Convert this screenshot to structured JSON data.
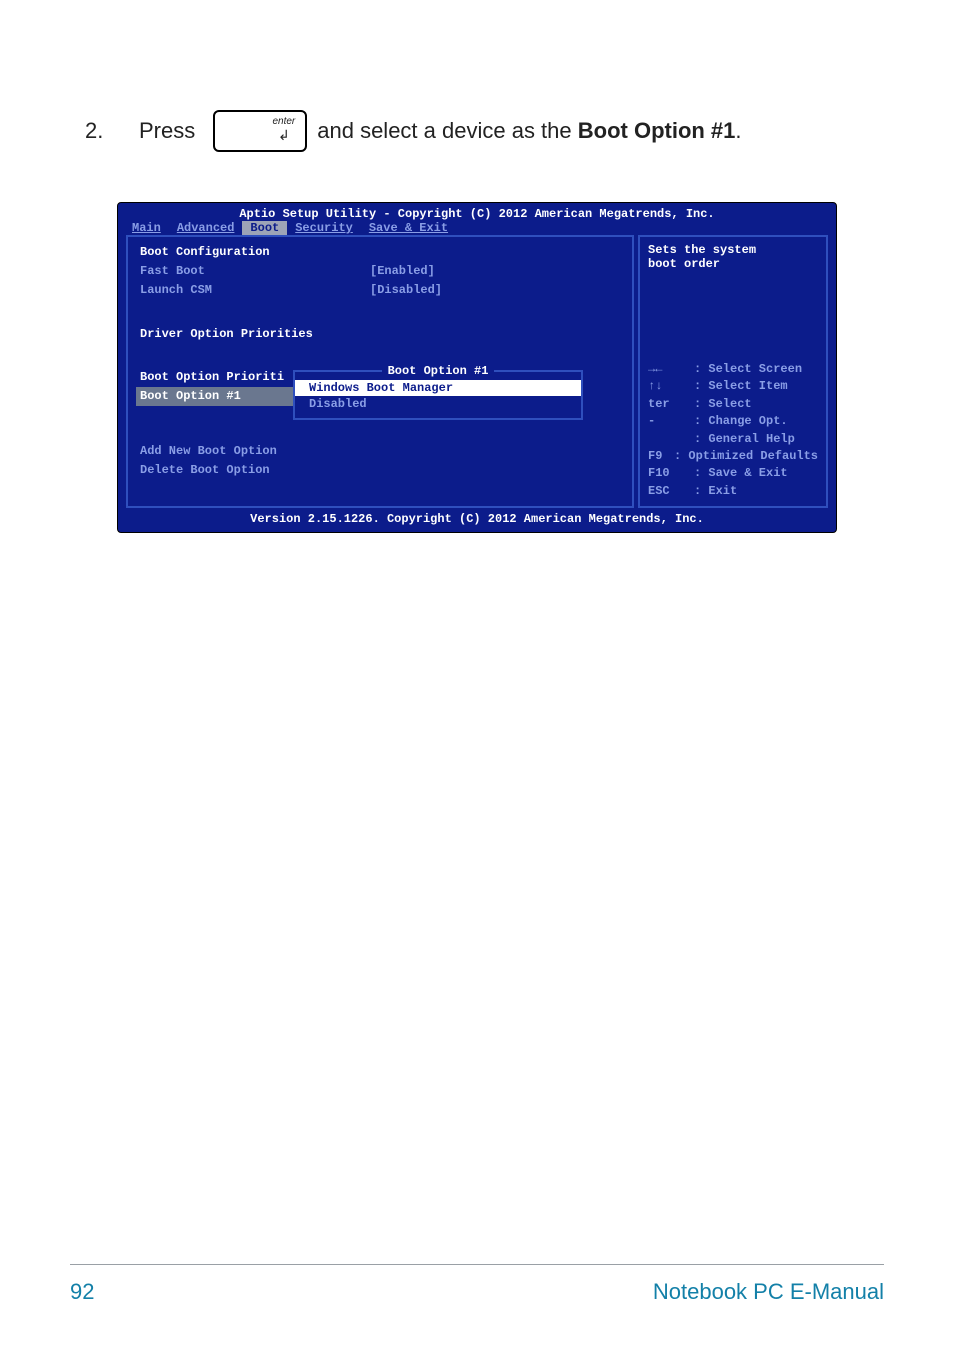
{
  "step": {
    "number": "2.",
    "press_label": "Press",
    "key_label": "enter",
    "tail_before": " and select a device as the ",
    "tail_bold": "Boot Option #1",
    "tail_after": "."
  },
  "bios": {
    "header": "Aptio Setup Utility - Copyright (C) 2012 American Megatrends, Inc.",
    "tabs": {
      "main": "Main",
      "advanced": "Advanced",
      "boot": "Boot",
      "security": "Security",
      "save_exit": "Save & Exit"
    },
    "left": {
      "boot_config": "Boot Configuration",
      "fast_boot_label": "Fast Boot",
      "fast_boot_value": "[Enabled]",
      "launch_csm_label": "Launch CSM",
      "launch_csm_value": "[Disabled]",
      "driver_priorities": "Driver Option Priorities",
      "boot_prioriti": "Boot Option Prioriti",
      "boot_option_1": "Boot Option #1",
      "add_new": "Add New Boot Option",
      "delete": "Delete Boot Option"
    },
    "popup": {
      "title": "Boot Option #1",
      "item_selected": "Windows Boot Manager",
      "item_disabled": "Disabled"
    },
    "right": {
      "desc_line1": "Sets the system",
      "desc_line2": "boot order",
      "help": {
        "select_screen_key": "→←",
        "select_screen": ": Select Screen",
        "select_item_key": "↑↓",
        "select_item": ": Select Item",
        "enter_key": "ter",
        "enter": ": Select",
        "change_key": "-",
        "change": ": Change Opt.",
        "general_key": "",
        "general": ": General Help",
        "optimized_key": "F9",
        "optimized": ": Optimized Defaults",
        "save_key": "F10",
        "save": ": Save & Exit",
        "exit_key": "ESC",
        "exit": ": Exit"
      }
    },
    "footer": "Version 2.15.1226. Copyright (C) 2012 American Megatrends, Inc."
  },
  "page_footer": {
    "page_number": "92",
    "manual_title": "Notebook PC E-Manual"
  }
}
